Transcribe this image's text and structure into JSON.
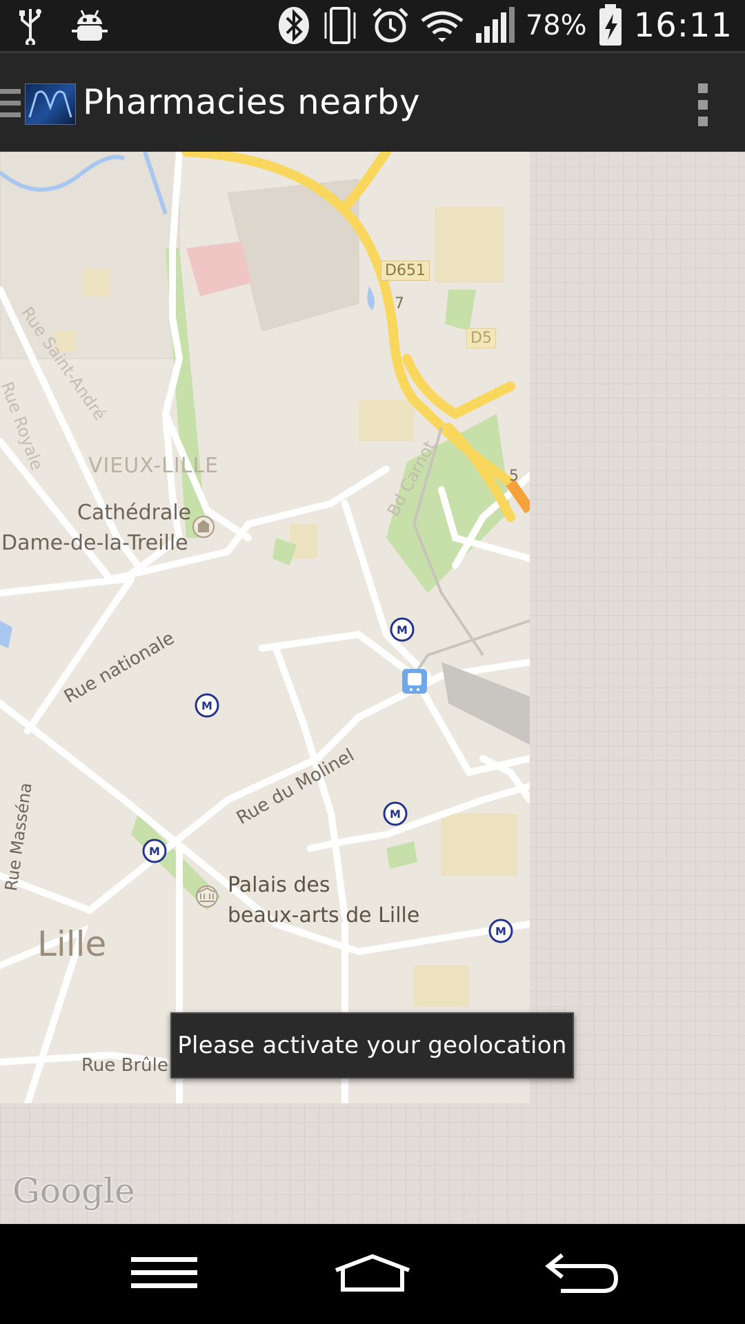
{
  "status_bar": {
    "battery": "78%",
    "time": "16:11",
    "icons": [
      "usb-icon",
      "android-debug-icon",
      "bluetooth-icon",
      "vibrate-icon",
      "alarm-icon",
      "wifi-icon",
      "signal-icon",
      "battery-charging-icon"
    ]
  },
  "action_bar": {
    "title": "Pharmacies nearby",
    "icons": [
      "drawer-icon",
      "app-logo",
      "overflow-menu-icon"
    ]
  },
  "map": {
    "labels": {
      "vieux_lille": "VIEUX-LILLE",
      "cathedrale_1": "Cathédrale",
      "cathedrale_2": "Dame-de-la-Treille",
      "palais_1": "Palais des",
      "palais_2": "beaux-arts de Lille",
      "lille": "Lille",
      "rue_nationale": "Rue nationale",
      "rue_molinel": "Rue du Molinel",
      "rue_massena": "Rue Masséna",
      "rue_brule": "Rue Brûle",
      "rue_st_andre": "Rue Saint-André",
      "rue_royale": "Rue Royale",
      "bd_carnot": "Bd Carnot",
      "d651": "D651",
      "d5": "D5",
      "exit_7": "7",
      "exit_5": "5",
      "metro": "M"
    },
    "attribution": "Google",
    "colors": {
      "land": "#ebe7df",
      "road": "#ffffff",
      "highway": "#f9d65c",
      "park": "#c7dfa8",
      "water": "#a7c7f0"
    }
  },
  "toast": {
    "message": "Please activate your geolocation"
  },
  "nav_bar": {
    "icons": [
      "menu-icon",
      "home-icon",
      "back-icon"
    ]
  }
}
